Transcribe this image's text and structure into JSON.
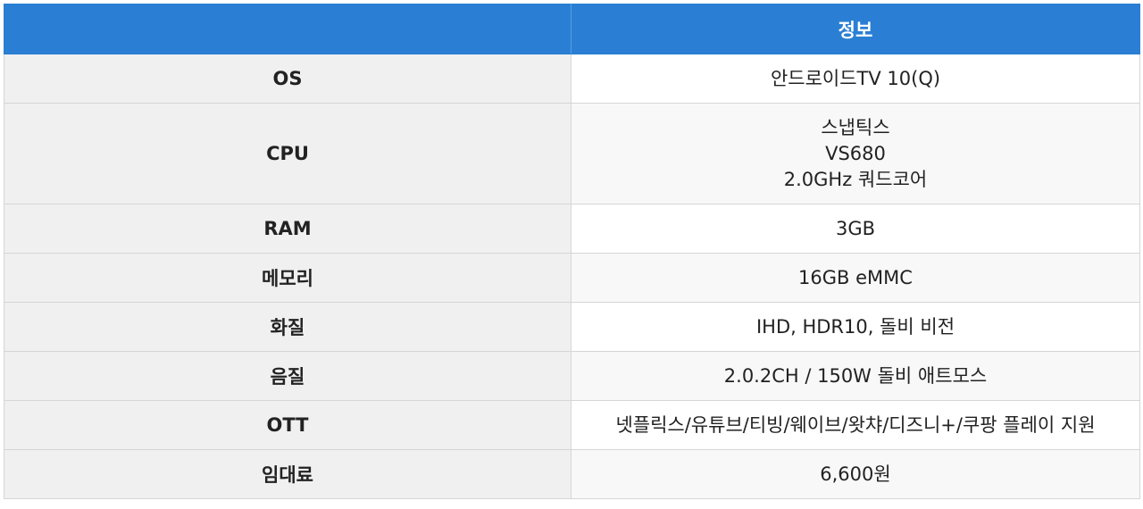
{
  "header": {
    "col1": "",
    "col2": "정보"
  },
  "rows": [
    {
      "label": "OS",
      "value": [
        "안드로이드TV 10(Q)"
      ]
    },
    {
      "label": "CPU",
      "value": [
        "스냅틱스",
        "VS680",
        "2.0GHz 쿼드코어"
      ]
    },
    {
      "label": "RAM",
      "value": [
        "3GB"
      ]
    },
    {
      "label": "메모리",
      "value": [
        "16GB eMMC"
      ]
    },
    {
      "label": "화질",
      "value": [
        "IHD, HDR10, 돌비 비전"
      ]
    },
    {
      "label": "음질",
      "value": [
        "2.0.2CH / 150W 돌비 애트모스"
      ]
    },
    {
      "label": "OTT",
      "value": [
        "넷플릭스/유튜브/티빙/웨이브/왓챠/디즈니+/쿠팡 플레이 지원"
      ]
    },
    {
      "label": "임대료",
      "value": [
        "6,600원"
      ]
    }
  ],
  "colors": {
    "header_bg": "#2a7fd4",
    "label_bg": "#f0f0f0"
  }
}
